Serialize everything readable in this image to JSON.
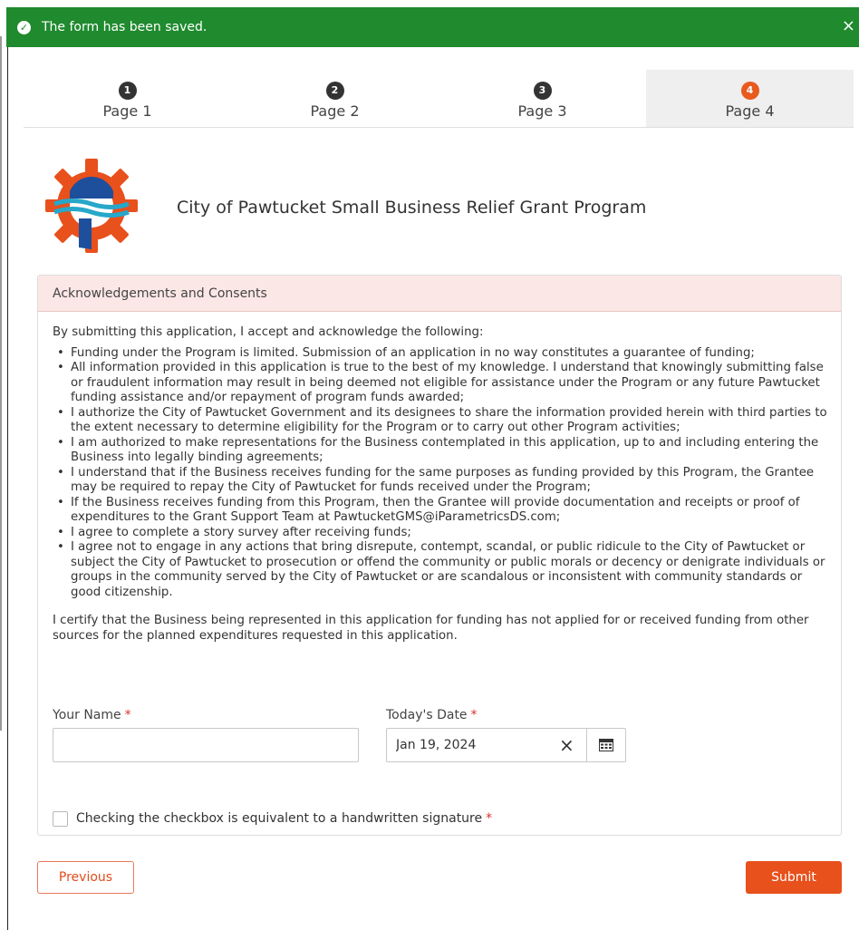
{
  "banner": {
    "message": "The form has been saved.",
    "close_label": "×",
    "icon": "check-circle-icon",
    "color": "#1f8a2e"
  },
  "steps": [
    {
      "number": "1",
      "label": "Page 1",
      "active": false
    },
    {
      "number": "2",
      "label": "Page 2",
      "active": false
    },
    {
      "number": "3",
      "label": "Page 3",
      "active": false
    },
    {
      "number": "4",
      "label": "Page 4",
      "active": true
    }
  ],
  "header": {
    "program_title": "City of Pawtucket Small Business Relief Grant Program",
    "logo_icon": "pawtucket-gear-logo"
  },
  "section": {
    "title": "Acknowledgements and Consents",
    "intro": "By submitting this application, I accept and acknowledge the following:",
    "items": [
      "Funding under the Program is limited. Submission of an application in no way constitutes a guarantee of funding;",
      "All information provided in this application is true to the best of my knowledge. I understand that knowingly submitting false or fraudulent information may result in being deemed not eligible for assistance under the Program or any future Pawtucket funding assistance and/or repayment of program funds awarded;",
      "I authorize the City of Pawtucket Government and its designees to share the information provided herein with third parties to the extent necessary to determine eligibility for the Program or to carry out other Program activities;",
      "I am authorized to make representations for the Business contemplated in this application, up to and including entering the Business into legally binding agreements;",
      "I understand that if the Business receives funding for the same purposes as funding provided by this Program, the Grantee may be required to repay the City of Pawtucket for funds received under the Program;",
      "If the Business receives funding from this Program, then the Grantee will provide documentation and receipts or proof of expenditures to the Grant Support Team at PawtucketGMS@iParametricsDS.com;",
      "I agree to complete a story survey after receiving funds;",
      "I agree not to engage in any actions that bring disrepute, contempt, scandal, or public ridicule to the City of Pawtucket or subject the City of Pawtucket to prosecution or offend the community or public morals or decency or denigrate individuals or groups in the community served by the City of Pawtucket or are scandalous or inconsistent with community standards or good citizenship."
    ],
    "certify": "I certify that the Business being represented in this application for funding has not applied for or received funding from other sources for the planned expenditures requested in this application."
  },
  "form": {
    "name_label": "Your Name",
    "name_value": "",
    "date_label": "Today's Date",
    "date_value": "Jan 19, 2024",
    "required_mark": "*",
    "clear_label": "×",
    "signature_label": "Checking the checkbox is equivalent to a handwritten signature"
  },
  "actions": {
    "previous_label": "Previous",
    "submit_label": "Submit",
    "accent_color": "#e8501c"
  }
}
